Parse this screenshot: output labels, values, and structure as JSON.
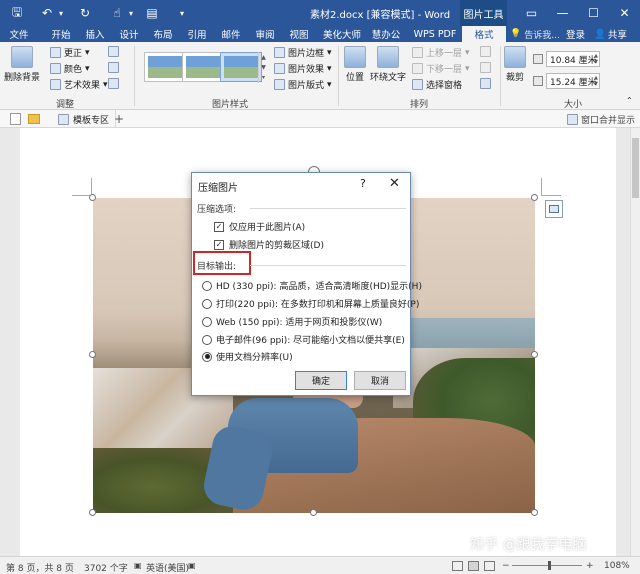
{
  "window": {
    "title": "素材2.docx [兼容模式] - Word",
    "contextual_tab_group": "图片工具",
    "minimize_glyph": "▭",
    "close_glyph": "✕",
    "maximize_glyph": "☐"
  },
  "quick_access": [
    {
      "icon": "save-icon",
      "glyph": "🖫"
    },
    {
      "icon": "undo-icon",
      "glyph": "↶"
    },
    {
      "icon": "dropdown-icon",
      "glyph": "▾"
    },
    {
      "icon": "redo-icon",
      "glyph": "↻"
    },
    {
      "icon": "touch-mode-icon",
      "glyph": "☝"
    },
    {
      "icon": "dropdown-icon",
      "glyph": "▾"
    },
    {
      "icon": "new-doc-icon",
      "glyph": "▤"
    },
    {
      "icon": "customize-icon",
      "glyph": "▾"
    }
  ],
  "tabs": [
    "文件",
    "开始",
    "插入",
    "设计",
    "布局",
    "引用",
    "邮件",
    "审阅",
    "视图",
    "美化大师",
    "慧办公",
    "WPS PDF",
    "格式"
  ],
  "active_tab": "格式",
  "tell_me": "告诉我...",
  "login": "登录",
  "share": "共享",
  "ribbon": {
    "adjust": {
      "remove_bg": "删除背景",
      "corrections": "更正",
      "color": "颜色",
      "artistic": "艺术效果",
      "label": "调整"
    },
    "picture_styles": {
      "border": "图片边框",
      "effects": "图片效果",
      "layout": "图片版式",
      "label": "图片样式"
    },
    "arrange": {
      "position": "位置",
      "wrap_text": "环绕文字",
      "bring_forward": "上移一层",
      "send_backward": "下移一层",
      "selection_pane": "选择窗格",
      "label": "排列"
    },
    "size": {
      "crop": "裁剪",
      "height": "10.84 厘米",
      "width": "15.24 厘米",
      "label": "大小"
    }
  },
  "doc_toolbar": {
    "tab": "模板专区",
    "merge_window": "窗口合并显示",
    "plus": "+"
  },
  "dialog": {
    "title": "压缩图片",
    "help": "?",
    "close": "✕",
    "section_options": "压缩选项:",
    "opt_this_picture": "仅应用于此图片(A)",
    "opt_delete_cropped": "删除图片的剪裁区域(D)",
    "opt_this_picture_checked": true,
    "opt_delete_cropped_checked": true,
    "section_output": "目标输出:",
    "radios": [
      {
        "label": "HD (330 ppi): 高品质，适合高清晰度(HD)显示(H)",
        "selected": false
      },
      {
        "label": "打印(220 ppi): 在多数打印机和屏幕上质量良好(P)",
        "selected": false
      },
      {
        "label": "Web (150 ppi): 适用于网页和投影仪(W)",
        "selected": false
      },
      {
        "label": "电子邮件(96 ppi): 尽可能缩小文档以便共享(E)",
        "selected": false
      },
      {
        "label": "使用文档分辨率(U)",
        "selected": true
      }
    ],
    "ok": "确定",
    "cancel": "取消",
    "check_glyph": "✓"
  },
  "status": {
    "page": "第 8 页，共 8 页",
    "words": "3702 个字",
    "language": "英语(美国)",
    "zoom": "108%",
    "zoom_minus": "−",
    "zoom_plus": "+"
  },
  "watermark": "知乎 @跟我学电脑",
  "colors": {
    "titlebar": "#2b579a",
    "highlight_red": "#d12626"
  }
}
